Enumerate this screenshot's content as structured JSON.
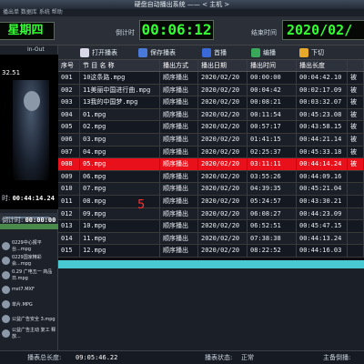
{
  "window": {
    "title": "硬盘自动播出系统 —— < 主机 >",
    "menu": "播出单 数据库 系统 帮助"
  },
  "top": {
    "date_text": "星期四",
    "countdown_label": "倒计时",
    "countdown_value": "00:06:12",
    "end_label": "结束时间",
    "end_value": "2020/02/"
  },
  "left": {
    "inout_label": "In-Out",
    "time_overlay": "32.51",
    "time_label": "时:",
    "time_value": "00:44:14.24",
    "countdown_label": "倒计时:",
    "countdown_value": "00:00:00",
    "playlist": [
      {
        "name": "0229中心报平台...mpg"
      },
      {
        "name": "0229国家精彩会...mpg"
      },
      {
        "name": "0.29 广电五一 商品日.mpg"
      },
      {
        "name": "mst7.MXF"
      },
      {
        "name": "单片.MPG"
      },
      {
        "name": "公益广告安全 3.mpg"
      },
      {
        "name": "公益广告主动 复工 释放..."
      }
    ]
  },
  "toolbar": {
    "open": "打开播表",
    "save": "保存播表",
    "play": "首播",
    "edit": "编播",
    "next": "下切"
  },
  "table": {
    "headers": [
      "序号",
      "节 目 名 称",
      "播出方式",
      "播出日期",
      "播出时间",
      "播出长度",
      ""
    ],
    "rows": [
      [
        "001",
        "10这条路.mpg",
        "顺序播出",
        "2020/02/20",
        "00:00:00",
        "00:04:42.10",
        "被"
      ],
      [
        "002",
        "11美丽中国进行曲.mpg",
        "顺序播出",
        "2020/02/20",
        "00:04:42",
        "00:02:17.09",
        "被"
      ],
      [
        "003",
        "13我的中国梦.mpg",
        "顺序播出",
        "2020/02/20",
        "00:08:21",
        "00:03:32.07",
        "被"
      ],
      [
        "004",
        "01.mpg",
        "顺序播出",
        "2020/02/20",
        "00:11:54",
        "00:45:23.08",
        "被"
      ],
      [
        "005",
        "02.mpg",
        "顺序播出",
        "2020/02/20",
        "00:57:17",
        "00:43:58.15",
        "被"
      ],
      [
        "006",
        "03.mpg",
        "顺序播出",
        "2020/02/20",
        "01:41:15",
        "00:44:21.14",
        "被"
      ],
      [
        "007",
        "04.mpg",
        "顺序播出",
        "2020/02/20",
        "02:25:37",
        "00:45:33.18",
        "被"
      ],
      [
        "008",
        "05.mpg",
        "顺序播出",
        "2020/02/20",
        "03:11:11",
        "00:44:14.24",
        "被"
      ],
      [
        "009",
        "06.mpg",
        "顺序播出",
        "2020/02/20",
        "03:55:26",
        "00:44:09.16",
        ""
      ],
      [
        "010",
        "07.mpg",
        "顺序播出",
        "2020/02/20",
        "04:39:35",
        "00:45:21.04",
        ""
      ],
      [
        "011",
        "08.mpg",
        "顺序播出",
        "2020/02/20",
        "05:24:57",
        "00:43:30.21",
        ""
      ],
      [
        "012",
        "09.mpg",
        "顺序播出",
        "2020/02/20",
        "06:08:27",
        "00:44:23.09",
        ""
      ],
      [
        "013",
        "10.mpg",
        "顺序播出",
        "2020/02/20",
        "06:52:51",
        "00:45:47.15",
        ""
      ],
      [
        "014",
        "11.mpg",
        "顺序播出",
        "2020/02/20",
        "07:38:38",
        "00:44:13.24",
        ""
      ],
      [
        "015",
        "12.mpg",
        "顺序播出",
        "2020/02/20",
        "08:22:52",
        "00:44:16.03",
        ""
      ]
    ],
    "selected_index": 7,
    "annotation": "5"
  },
  "status": {
    "total_label": "播表总长度:",
    "total_value": "09:05:46.22",
    "state_label": "播表状态:",
    "state_value": "正常",
    "host_label": "主备倒播:",
    "host_value": ""
  }
}
